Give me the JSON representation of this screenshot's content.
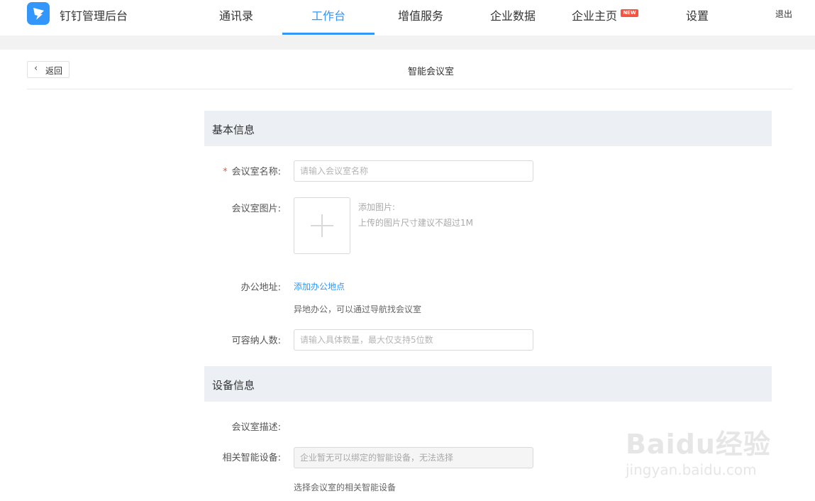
{
  "header": {
    "app_title": "钉钉管理后台",
    "nav": [
      {
        "label": "通讯录"
      },
      {
        "label": "工作台",
        "active": true
      },
      {
        "label": "增值服务"
      },
      {
        "label": "企业数据"
      },
      {
        "label": "企业主页",
        "badge": "NEW"
      },
      {
        "label": "设置"
      }
    ],
    "logout": "退出"
  },
  "subheader": {
    "back_label": "返回",
    "title": "智能会议室"
  },
  "sections": {
    "basic": {
      "title": "基本信息",
      "name_label": "会议室名称:",
      "name_required_mark": "*",
      "name_placeholder": "请输入会议室名称",
      "image_label": "会议室图片:",
      "image_hint_title": "添加图片:",
      "image_hint_desc": "上传的图片尺寸建议不超过1M",
      "address_label": "办公地址:",
      "address_link": "添加办公地点",
      "address_hint": "异地办公，可以通过导航找会议室",
      "capacity_label": "可容纳人数:",
      "capacity_placeholder": "请输入具体数量，最大仅支持5位数"
    },
    "device": {
      "title": "设备信息",
      "desc_label": "会议室描述:",
      "smart_device_label": "相关智能设备:",
      "smart_device_placeholder": "企业暂无可以绑定的智能设备，无法选择",
      "smart_device_hint": "选择会议室的相关智能设备"
    }
  },
  "watermark": {
    "brand": "Baidu经验",
    "url": "jingyan.baidu.com"
  },
  "colors": {
    "accent": "#3296fa",
    "badge": "#f25643",
    "section_bg": "#eceff3"
  }
}
